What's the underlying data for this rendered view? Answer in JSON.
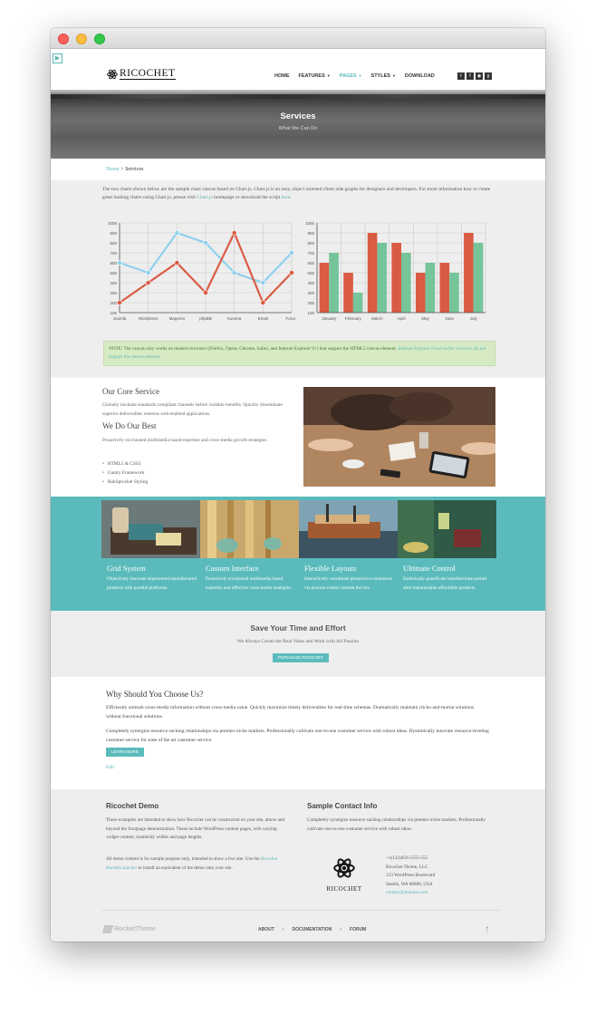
{
  "header": {
    "logo_text": "RICOCHET",
    "nav": [
      {
        "label": "HOME",
        "caret": false,
        "active": false
      },
      {
        "label": "FEATURES",
        "caret": true,
        "active": false
      },
      {
        "label": "PAGES",
        "caret": true,
        "active": true
      },
      {
        "label": "STYLES",
        "caret": true,
        "active": false
      },
      {
        "label": "DOWNLOAD",
        "caret": false,
        "active": false
      }
    ],
    "social": [
      "t",
      "f",
      "rss",
      "g+"
    ]
  },
  "hero": {
    "title": "Services",
    "subtitle": "What We Can Do"
  },
  "breadcrumb": {
    "home": "Home",
    "separator": ">",
    "current": "Services"
  },
  "intro": {
    "text_before": "The two charts shown below are the sample chart canvas based on Chart.js. Chart.js is an easy, object oriented client side graphs for designers and developers. For more information how to create great looking charts using Chart.js, please visit ",
    "link1": "Chart.js",
    "text_mid": " homepage or download the script ",
    "link2": "here",
    "text_end": "."
  },
  "chart_data": [
    {
      "type": "line",
      "categories": [
        "Joomla",
        "Wordpress",
        "Magento",
        "phpBB",
        "Kunena",
        "Email",
        "Forum"
      ],
      "series": [
        {
          "values": [
            600,
            500,
            900,
            800,
            500,
            400,
            700
          ],
          "color": "#8fd0ee"
        },
        {
          "values": [
            200,
            400,
            600,
            300,
            900,
            200,
            500
          ],
          "color": "#d95b43"
        }
      ],
      "ylim": [
        100,
        1000
      ],
      "yticks": [
        100,
        200,
        300,
        400,
        500,
        600,
        700,
        800,
        900,
        1000
      ],
      "grid": true
    },
    {
      "type": "bar",
      "categories": [
        "January",
        "February",
        "March",
        "April",
        "May",
        "June",
        "July"
      ],
      "series": [
        {
          "values": [
            600,
            500,
            900,
            800,
            500,
            600,
            900
          ],
          "color": "#d95b43"
        },
        {
          "values": [
            700,
            300,
            800,
            700,
            600,
            500,
            800
          ],
          "color": "#76c49a"
        }
      ],
      "ylim": [
        100,
        1000
      ],
      "yticks": [
        100,
        200,
        300,
        400,
        500,
        600,
        700,
        800,
        900,
        1000
      ],
      "grid": true
    }
  ],
  "note": {
    "text": "NOTE: The canvas only works on modern browsers (Firefox, Opera, Chrome, Safari, and Internet Explorer 9+) that support the HTML5 canvas element. ",
    "link": "Internet Explorer 8 and earlier versions, do not support the canvas element."
  },
  "core": {
    "title": "Our Core Service",
    "text": "Globally incubate standards compliant channels before scalable benefits. Quickly disseminate superior deliverables whereas web-enabled applications.",
    "best_title": "We Do Our Best",
    "best_text": "Proactively envisioned multimedia based expertise and cross-media growth strategies.",
    "bullets": [
      "HTML5 & CSS3",
      "Gantry Framework",
      "RokSprocket Styling"
    ]
  },
  "features": [
    {
      "title": "Grid System",
      "text": "Objectively innovate empowered manufactured products with parallel platforms."
    },
    {
      "title": "Custom Interface",
      "text": "Proactively envisioned multimedia based expertise and effective cross-media strategies."
    },
    {
      "title": "Flexible Layouts",
      "text": "Interactively coordinate proactive e-commerce via process-centric outside the box."
    },
    {
      "title": "Ultimate Control",
      "text": "Holistically pontificate installed base portals after maintainable affordable products."
    }
  ],
  "save": {
    "title": "Save Your Time and Effort",
    "subtitle": "We Always Create the Real Value and Work with All Passion",
    "button": "PURCHASE RICOCHET"
  },
  "why": {
    "title": "Why Should You Choose Us?",
    "p1": "Efficiently unleash cross-media information without cross-media value. Quickly maximize timely deliverables for real-time schemas. Dramatically maintain clicks-and-mortar solutions without functional solutions.",
    "p2": "Completely synergize resource sucking relationships via premier niche markets. Professionally cultivate one-to-one customer service with robust ideas. Dynamically innovate resource-leveling customer service for state of the art customer service.",
    "button": "LEARN MORE",
    "edit": "Edit"
  },
  "footer": {
    "demo_title": "Ricochet Demo",
    "demo_p1": "These examples are intended to show how Ricochet can be constructed on your site, above and beyond the frontpage demonstration. These include WordPress content pages, with varying widget content, mainbody widths and page lengths.",
    "demo_p2_before": "All demo content is for sample purpose only, intended to show a live site. Use the ",
    "demo_p2_link": "Ricochet RocketLauncher",
    "demo_p2_after": " to install an equivalent of the demo onto your site.",
    "contact_title": "Sample Contact Info",
    "contact_text": "Completely synergize resource sucking relationships via premier niche markets. Professionally cultivate one-to-one customer service with robust ideas.",
    "logo_text": "RICOCHET",
    "phone": "+1(123)456-5555-555",
    "company": "Ricochet Theme, LLC",
    "street": "123 WordPress Boulevard",
    "city": "Seattle, WA 00000, USA",
    "email": "noreply@domain.com",
    "brand": "RocketTheme",
    "nav": [
      "ABOUT",
      "DOCUMENTATION",
      "FORUM"
    ],
    "nav_sep": "•"
  }
}
